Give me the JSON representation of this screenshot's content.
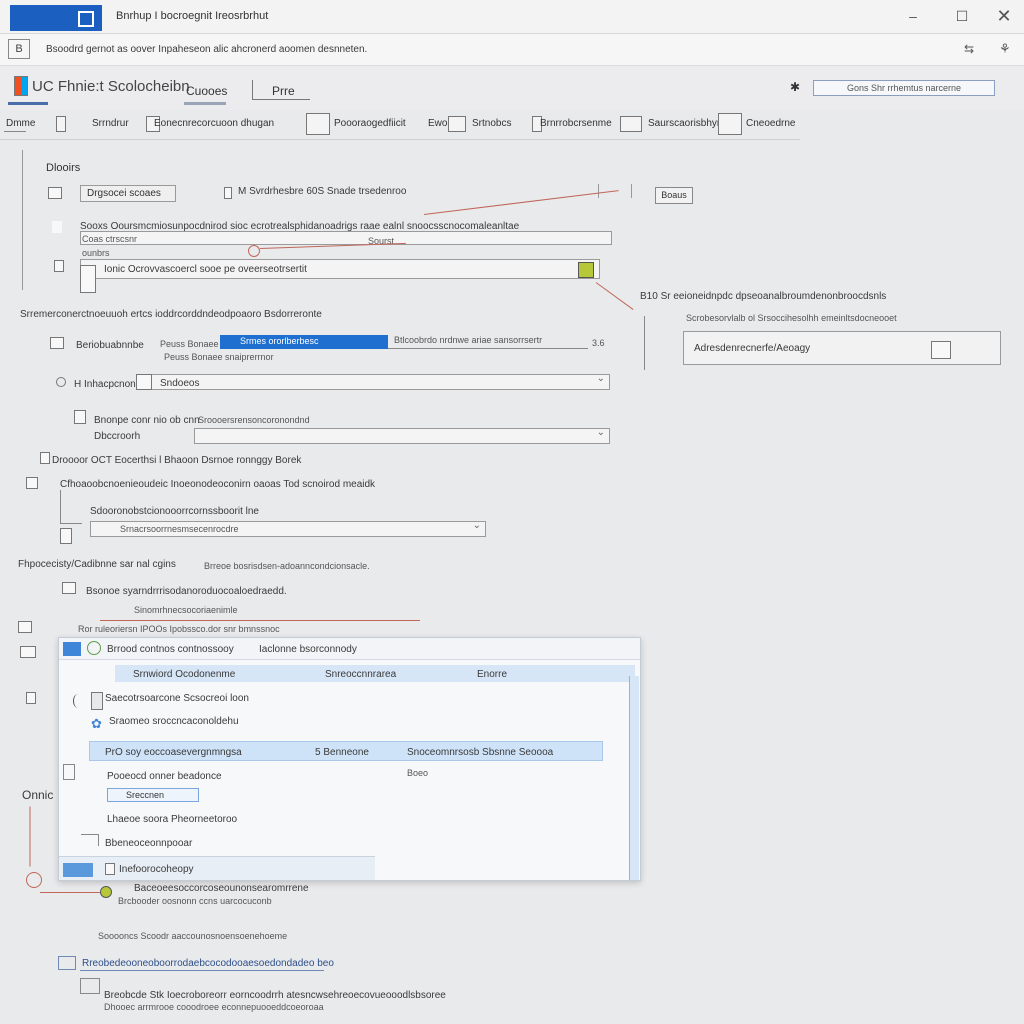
{
  "window": {
    "title": "Bnrhup I bocroegnit Ireosrbrhut",
    "address": "Bsoodrd gernot as oover Inpaheseon alic ahcronerd aoomen desnneten."
  },
  "header": {
    "brand": "UC Fhnie:t Scolocheibn",
    "tabs": [
      {
        "label": "Cuooes"
      },
      {
        "label": "Prre"
      }
    ],
    "search_placeholder": "Gons Shr rrhemtus narcerne"
  },
  "toolbar": {
    "items": [
      {
        "label": "Dmme"
      },
      {
        "label": "Srrndrur"
      },
      {
        "label": "Eonecnrecorcuoon dhugan"
      },
      {
        "label": "Poooraogedfiicit"
      },
      {
        "label": "Ewo"
      },
      {
        "label": "Srtnobcs"
      },
      {
        "label": "Brnrrobcrsenme"
      },
      {
        "label": "Saurscaorisbhyrt"
      },
      {
        "label": "Cneoedrne"
      }
    ]
  },
  "form": {
    "section_title": "Dlooirs",
    "primary_button": "Drgsocei scoaes",
    "primary_desc": "M Svrdrhesbre 60S Snade trsedenroo",
    "confirm_label": "Boaus",
    "desc_line": "Sooxs Ooursmcmiosunpocdnirod sioc ecrotrealsphidanoadrigs raae ealnl snoocsscnocomaleanltae",
    "sub_a": "Coas ctrscsnr",
    "sub_b": "ounbrs",
    "sub_b_right": "Sourst",
    "row_label": "Ionic Ocrovvascoercl sooe pe oveerseotrsertit",
    "note_right_1": "B10 Sr eeioneidnpdc dpseoanalbroumdenonbroocdsnls",
    "note_right_2": "Scrobesorvlalb ol Srsoccihesolhh emeinltsdocneooet",
    "right_panel_label": "Adresdenrecnerfe/Aeoagy",
    "section2_title": "Srremerconerctnoeuuoh ertcs ioddrcorddndeodpoaoro Bsdorreronte",
    "control_label": "Beriobuabnnbe",
    "control_hint": "Peuss Bonaee snaiprerrnor",
    "slider_value_label": "Srmes ororlberbesc",
    "slider_desc": "Btlcoobrdo nrdnwe ariae sansorrsertr",
    "slider_max": "3.6",
    "item_a_label": "H Inhacpcnon",
    "item_a_value": "Sndoeos",
    "item_b_label": "Bnonpe conr nio ob cnn",
    "item_b_value": "Sroooersrensoncoronondnd",
    "item_b_hint": "Dbccroorh",
    "section3_title": "Droooor OCT Eocerthsi l Bhaoon Dsrnoe ronnggy Borek",
    "s3_desc": "Cfhoaoobcnoenieoudeic Inoeonodeoconirn oaoas Tod scnoirod meaidk",
    "s3_sub": "Sdooronobstcionooorrcornssboorit lne",
    "s3_dropdown": "Srnacrsoorrnesmsecenrocdre",
    "section4_title": "Fhpocecisty/Cadibnne sar nal cgins",
    "section4_desc": "Brreoe bosrisdsen-adoanncondcionsacle.",
    "s4_item": "Bsonoe syarndrrrisodanoroduocoaloedraedd.",
    "s4_link": "Sinomrhnecsocoriaenimle",
    "s4_line": "Ror ruleoriersn IPOOs Ipobssco.dor snr bmnssnoc"
  },
  "popup": {
    "title": "Brrood contnos contnossooy",
    "title_right": "Iaclonne bsorconnody",
    "tab_a": "Srnwiord Ocodonenme",
    "tab_b": "Snreoccnnrarea",
    "tab_c": "Enorre",
    "row1": "Saecotrsoarcone Scsocreoi loon",
    "row2": "Sraomeo sroccncaconoldehu",
    "sel_left": "PrO soy eoccoasevergnmngsa",
    "sel_mid": "5 Benneone",
    "sel_right": "Snoceomnrsosb Sbsnne Seoooa",
    "sel_hint": "Boeo",
    "row3": "Pooeocd onner beadonce",
    "input_value": "Sreccnen",
    "row4": "Lhaeoe soora Pheorneetoroo",
    "row5": "Bbeneoceonnpooar",
    "footer_label": "Inefoorocoheopy"
  },
  "lower": {
    "side_label": "Onnic",
    "line1": "Baceoeesoccorcoseounonsearomrrene",
    "line2": "Brcbooder oosnonn ccns uarcocuconb",
    "line3": "Sooooncs Scoodr aaccounosnoensoenehoeme",
    "link_row": "Rreobedeooneoboorrodaebcocodooaesoedondadeo beo",
    "footer1": "Breobcde Stk Ioecroboreorr eorncoodrrh atesncwsehreoecovueooodlsbsoree",
    "footer2": "Dhooec arrmrooe cooodroee econnepuooeddcoeoroaa"
  }
}
